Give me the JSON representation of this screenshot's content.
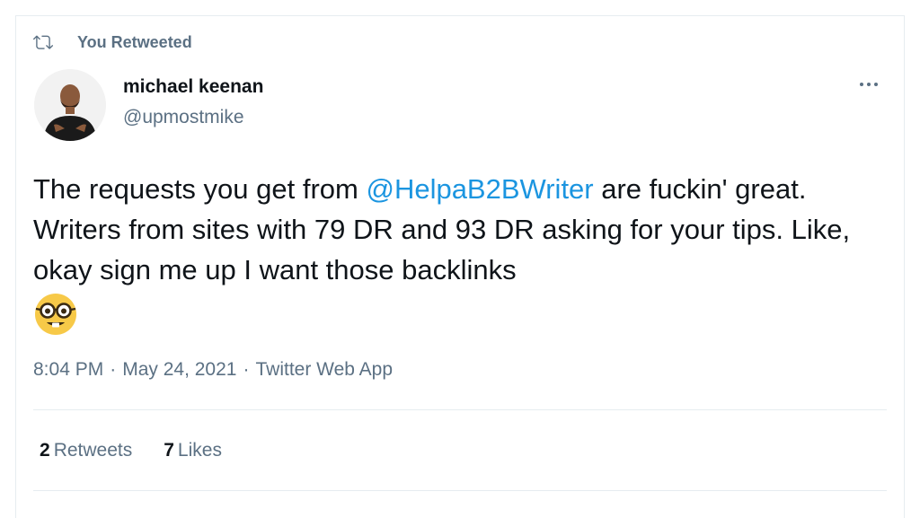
{
  "context": {
    "retweet_label": "You Retweeted",
    "retweet_icon": "retweet-icon"
  },
  "author": {
    "name": "michael keenan",
    "handle": "@upmostmike",
    "avatar_icon": "avatar"
  },
  "tweet": {
    "text_before": "The requests you get from ",
    "mention": "@HelpaB2BWriter",
    "text_after": " are fuckin' great. Writers from sites with 79 DR and 93 DR asking for your tips. Like, okay sign me up I want those backlinks",
    "emoji_icon": "nerd-face-emoji"
  },
  "meta": {
    "time": "8:04 PM",
    "separator": "·",
    "date": "May 24, 2021",
    "source": "Twitter Web App"
  },
  "stats": {
    "retweets_count": "2",
    "retweets_label": "Retweets",
    "likes_count": "7",
    "likes_label": "Likes"
  },
  "colors": {
    "accent": "#1b95e0",
    "secondary_text": "#5b7083",
    "primary_text": "#0f1419",
    "border": "#e6ecf0"
  }
}
